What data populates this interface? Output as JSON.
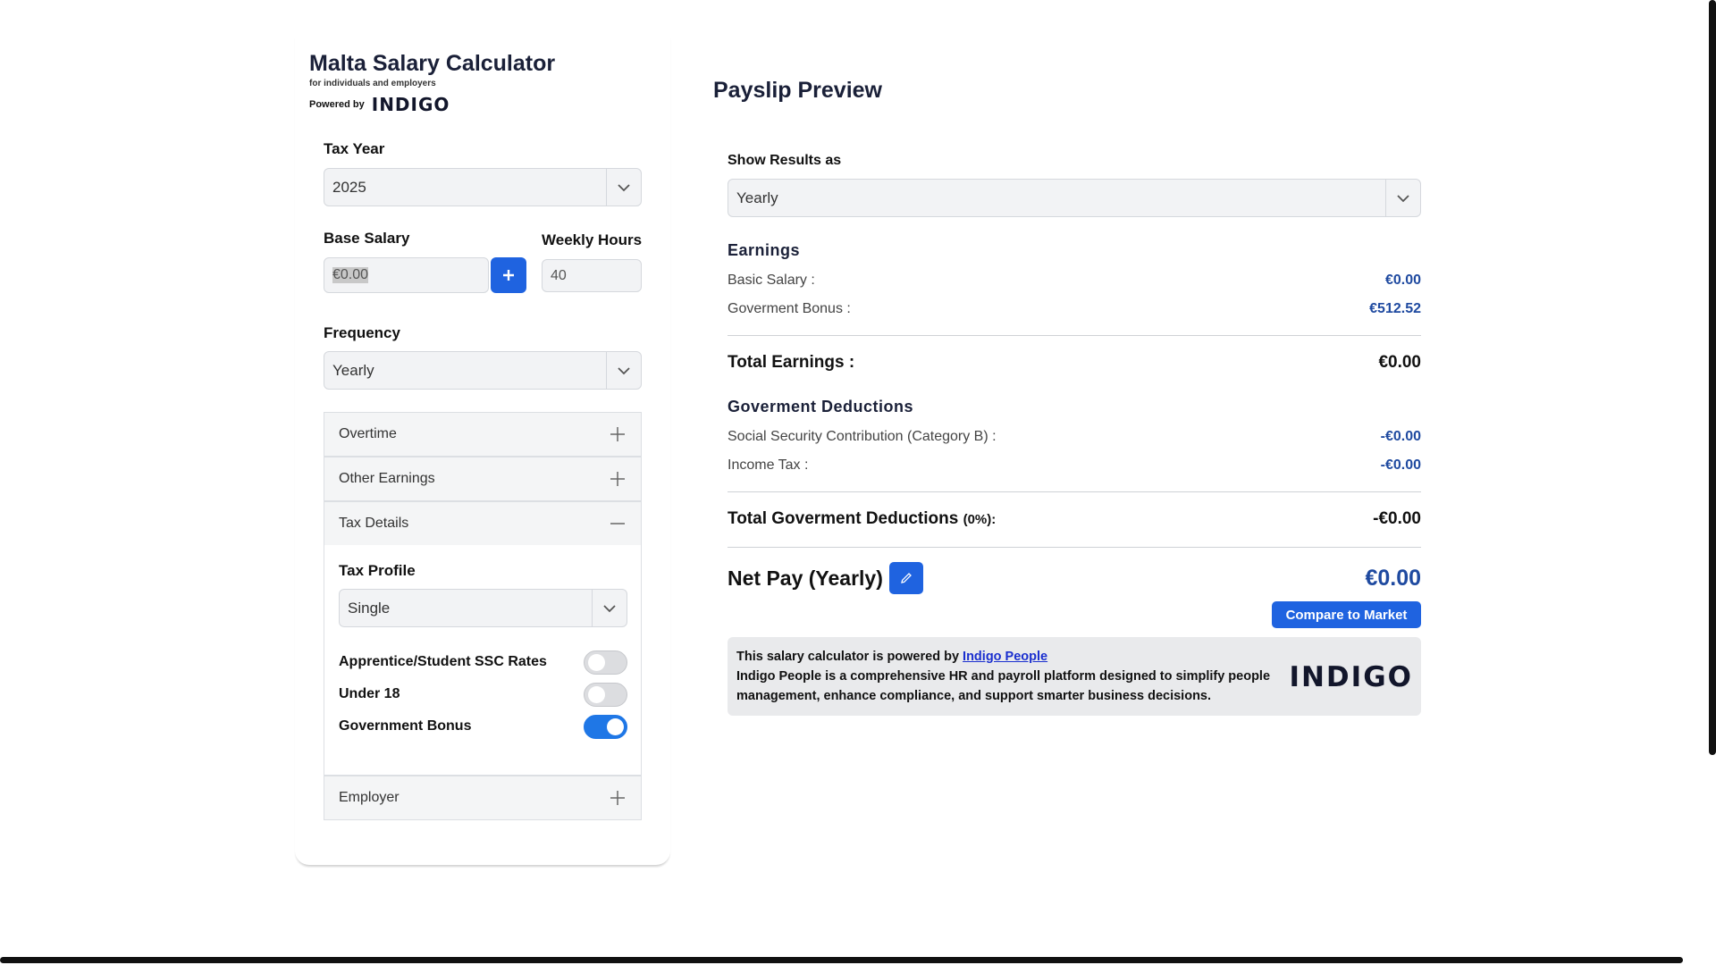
{
  "brand": {
    "title": "Malta Salary Calculator",
    "subtitle": "for individuals and employers",
    "powered_by": "Powered by",
    "logo_text": "INDIGO"
  },
  "form": {
    "tax_year": {
      "label": "Tax Year",
      "value": "2025"
    },
    "base_salary": {
      "label": "Base Salary",
      "value": "€0.00"
    },
    "weekly_hours": {
      "label": "Weekly Hours",
      "value": "40"
    },
    "frequency": {
      "label": "Frequency",
      "value": "Yearly"
    },
    "accordions": {
      "overtime": "Overtime",
      "other_earnings": "Other Earnings",
      "tax_details": "Tax Details",
      "employer": "Employer"
    },
    "tax_profile": {
      "label": "Tax Profile",
      "value": "Single"
    },
    "toggles": {
      "apprentice": {
        "label": "Apprentice/Student SSC Rates",
        "on": false
      },
      "under18": {
        "label": "Under 18",
        "on": false
      },
      "gov_bonus": {
        "label": "Government Bonus",
        "on": true
      }
    }
  },
  "preview": {
    "title": "Payslip Preview",
    "show_results_label": "Show Results as",
    "show_results_value": "Yearly",
    "earnings_title": "Earnings",
    "basic_salary_label": "Basic Salary :",
    "basic_salary_value": "€0.00",
    "gov_bonus_label": "Goverment Bonus :",
    "gov_bonus_value": "€512.52",
    "total_earnings_label": "Total Earnings :",
    "total_earnings_value": "€0.00",
    "deductions_title": "Goverment Deductions",
    "ssc_label": "Social Security Contribution (Category B) :",
    "ssc_value": "-€0.00",
    "income_tax_label": "Income Tax :",
    "income_tax_value": "-€0.00",
    "total_deductions_label": "Total Goverment Deductions",
    "total_deductions_pct": "(0%):",
    "total_deductions_value": "-€0.00",
    "net_pay_label": "Net Pay (Yearly)",
    "net_pay_value": "€0.00",
    "compare_button": "Compare to Market",
    "promo_line1": "This salary calculator is powered by",
    "promo_link": "Indigo People",
    "promo_line2": "Indigo People is a comprehensive HR and payroll platform designed to simplify people management, enhance compliance, and support smarter business decisions.",
    "promo_logo": "INDIGO"
  },
  "colors": {
    "accent": "#1f63e0",
    "value_blue": "#1f4aa0",
    "toggle_on": "#1f77e6"
  }
}
